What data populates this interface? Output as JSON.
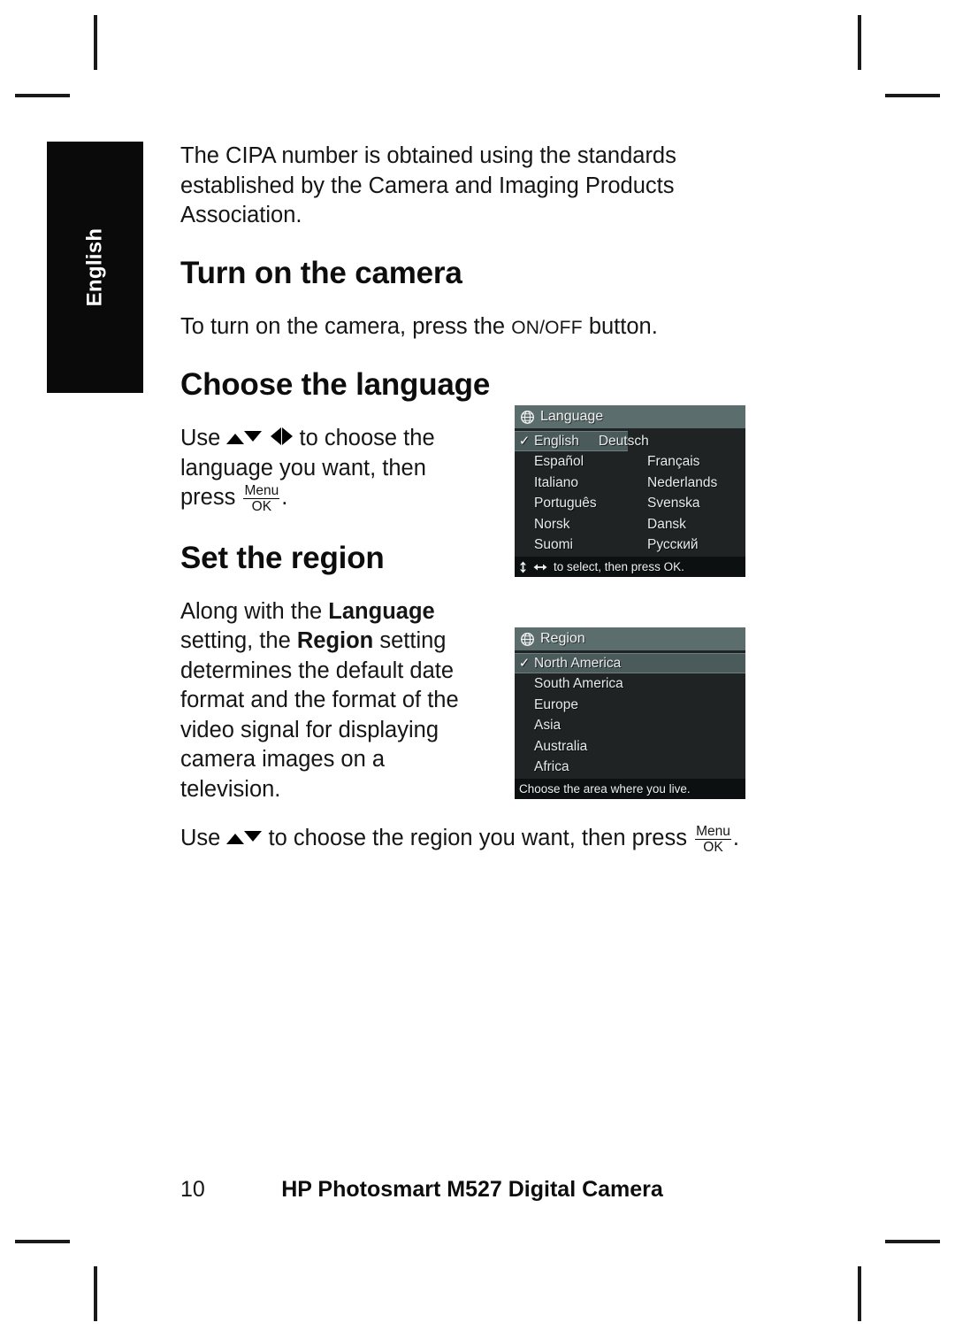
{
  "side_tab": {
    "label": "English"
  },
  "intro": {
    "text": "The CIPA number is obtained using the standards established by the Camera and Imaging Products Association."
  },
  "section_turn_on": {
    "heading": "Turn on the camera",
    "body_before": "To turn on the camera, press the ",
    "button_name": "ON/OFF",
    "body_after": " button."
  },
  "section_choose_language": {
    "heading": "Choose the language",
    "instruction_part1": "Use ",
    "instruction_part2": " to choose the language you want, then press ",
    "instruction_end": "."
  },
  "section_set_region": {
    "heading": "Set the region",
    "paragraph_1_a": "Along with the ",
    "paragraph_1_b": "Language",
    "paragraph_1_c": " setting, the ",
    "paragraph_1_d": "Region",
    "paragraph_1_e": " setting determines the default date format and the format of the video signal for displaying camera images on a television.",
    "instruction_part1": "Use ",
    "instruction_part2": " to choose the region you want, then press ",
    "instruction_end": "."
  },
  "menu_button": {
    "top": "Menu",
    "bottom": "OK"
  },
  "lcd_language": {
    "title": "Language",
    "icon": "globe-icon",
    "rows": [
      {
        "left": "English",
        "left_selected": true,
        "right": "Deutsch",
        "right_selected": false
      },
      {
        "left": "Español",
        "left_selected": false,
        "right": "Français",
        "right_selected": false
      },
      {
        "left": "Italiano",
        "left_selected": false,
        "right": "Nederlands",
        "right_selected": false
      },
      {
        "left": "Português",
        "left_selected": false,
        "right": "Svenska",
        "right_selected": false
      },
      {
        "left": "Norsk",
        "left_selected": false,
        "right": "Dansk",
        "right_selected": false
      },
      {
        "left": "Suomi",
        "left_selected": false,
        "right": "Русский",
        "right_selected": false
      }
    ],
    "footer": "to select, then press OK.",
    "check_glyph": "✓"
  },
  "lcd_region": {
    "title": "Region",
    "icon": "globe-icon",
    "items": [
      {
        "label": "North America",
        "selected": true
      },
      {
        "label": "South America",
        "selected": false
      },
      {
        "label": "Europe",
        "selected": false
      },
      {
        "label": "Asia",
        "selected": false
      },
      {
        "label": "Australia",
        "selected": false
      },
      {
        "label": "Africa",
        "selected": false
      }
    ],
    "footer": "Choose the area where you live.",
    "check_glyph": "✓"
  },
  "footer": {
    "page_number": "10",
    "document_title": "HP Photosmart M527 Digital Camera"
  },
  "colors": {
    "lcd_header_bg": "#5c6d6d",
    "lcd_body_bg": "#1f2323",
    "lcd_selected_bg": "#4b5a5a",
    "lcd_footer_bg": "#0d1010",
    "side_tab_bg": "#0a0a0a",
    "text": "#000000"
  }
}
